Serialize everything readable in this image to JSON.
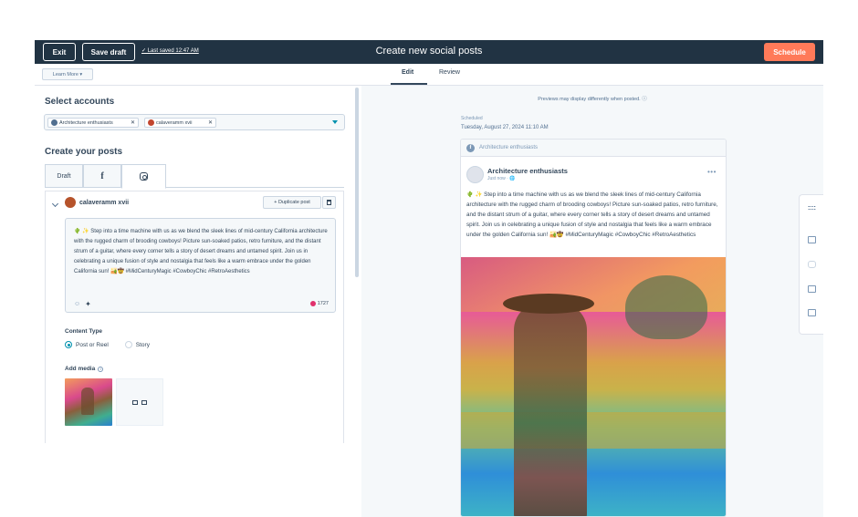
{
  "topbar": {
    "exit_label": "Exit",
    "save_draft_label": "Save draft",
    "last_saved": "✓ Last saved 12:47 AM",
    "title": "Create new social posts",
    "schedule_label": "Schedule",
    "colors": {
      "bar": "#213343",
      "schedule": "#ff7a59"
    }
  },
  "subbar": {
    "learn_more": "Learn More ▾",
    "tabs": [
      {
        "label": "Edit",
        "active": true
      },
      {
        "label": "Review",
        "active": false
      }
    ]
  },
  "left": {
    "select_accounts_heading": "Select accounts",
    "accounts": [
      {
        "label": "Architecture enthusiasts",
        "icon": "facebook-avatar-icon"
      },
      {
        "label": "calaveramm xvii",
        "icon": "instagram-avatar-icon"
      }
    ],
    "create_heading": "Create your posts",
    "network_tabs": [
      {
        "label": "Draft"
      },
      {
        "label": "f",
        "icon": "facebook-icon"
      },
      {
        "label": "",
        "icon": "instagram-icon",
        "active": true
      }
    ],
    "post": {
      "account_name": "calaveramm xvii",
      "duplicate_label": "+ Duplicate post",
      "text": "🌵 ✨ Step into a time machine with us as we blend the sleek lines of mid-century California architecture with the rugged charm of brooding cowboys! Picture sun-soaked patios, retro furniture, and the distant strum of a guitar, where every corner tells a story of desert dreams and untamed spirit. Join us in celebrating a unique fusion of style and nostalgia that feels like a warm embrace under the golden California sun! 🏜️🤠 #MidCenturyMagic #CowboyChic #RetroAesthetics",
      "char_count": "1727",
      "content_type_label": "Content Type",
      "content_types": [
        {
          "label": "Post or Reel",
          "selected": true
        },
        {
          "label": "Story",
          "selected": false
        }
      ],
      "add_media_label": "Add media"
    }
  },
  "right": {
    "preview_note": "Previews may display differently when posted. ⓘ",
    "scheduled_label": "Scheduled",
    "scheduled_date": "Tuesday, August 27, 2024 11:10 AM",
    "strip_label": "Architecture enthusiasts",
    "author": "Architecture enthusiasts",
    "time": "Just now · 🌐",
    "more": "•••",
    "text": "🌵 ✨ Step into a time machine with us as we blend the sleek lines of mid-century California architecture with the rugged charm of brooding cowboys! Picture sun-soaked patios, retro furniture, and the distant strum of a guitar, where every corner tells a story of desert dreams and untamed spirit. Join us in celebrating a unique fusion of style and nostalgia that feels like a warm embrace under the golden California sun! 🏜️🤠 #MidCenturyMagic #CowboyChic #RetroAesthetics"
  }
}
